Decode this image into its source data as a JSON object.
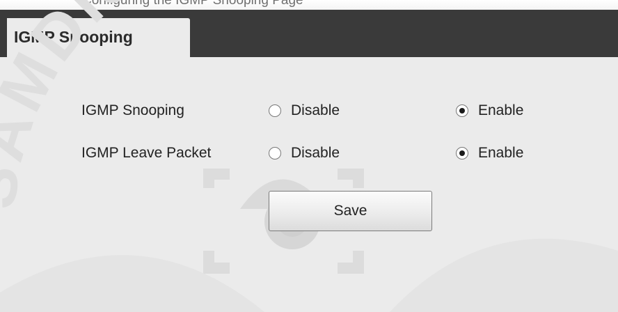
{
  "header": {
    "cropped_text": "Configuring the IGMP Snooping Page"
  },
  "tab": {
    "label": "IGMP Snooping"
  },
  "form": {
    "rows": [
      {
        "label": "IGMP Snooping",
        "options": [
          {
            "label": "Disable",
            "selected": false
          },
          {
            "label": "Enable",
            "selected": true
          }
        ]
      },
      {
        "label": "IGMP Leave Packet",
        "options": [
          {
            "label": "Disable",
            "selected": false
          },
          {
            "label": "Enable",
            "selected": true
          }
        ]
      }
    ],
    "save_label": "Save"
  },
  "watermark": {
    "text": "SAMDISTRIBUTION",
    "color": "#d9d9d9"
  },
  "colors": {
    "tab_bar": "#3a3a3a",
    "panel_bg": "#ebebeb"
  }
}
